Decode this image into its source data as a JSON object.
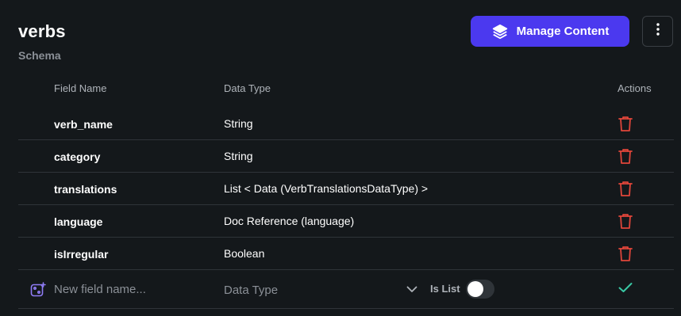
{
  "collection": {
    "title": "verbs",
    "subtitle": "Schema"
  },
  "toolbar": {
    "manage_label": "Manage Content",
    "manage_icon": "layers-icon",
    "more_icon": "more-vertical-icon"
  },
  "table": {
    "headers": {
      "field_name": "Field Name",
      "data_type": "Data Type",
      "actions": "Actions"
    },
    "rows": [
      {
        "name": "verb_name",
        "type": "String"
      },
      {
        "name": "category",
        "type": "String"
      },
      {
        "name": "translations",
        "type": "List < Data (VerbTranslationsDataType) >"
      },
      {
        "name": "language",
        "type": "Doc Reference (language)"
      },
      {
        "name": "isIrregular",
        "type": "Boolean"
      }
    ]
  },
  "new_field": {
    "placeholder": "New field name...",
    "data_type_placeholder": "Data Type",
    "is_list_label": "Is List",
    "is_list": false
  },
  "colors": {
    "accent": "#4b39ef",
    "danger": "#e0453a",
    "success": "#39c8a4",
    "background": "#14181b"
  }
}
